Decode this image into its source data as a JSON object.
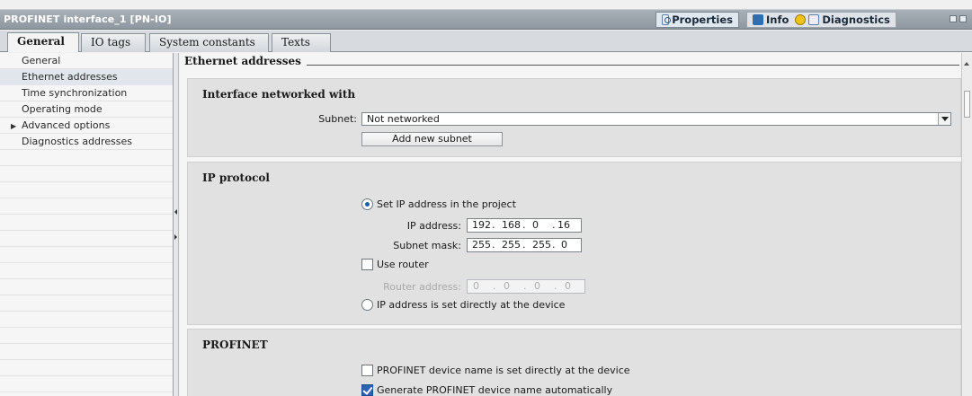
{
  "window": {
    "title": "PROFINET interface_1 [PN-IO]",
    "inspector_tabs": [
      {
        "label": "Properties",
        "icon": "properties-icon",
        "active": true
      },
      {
        "label": "Info",
        "icon": "info-icon",
        "active": false
      },
      {
        "label": "Diagnostics",
        "icon": "diagnostics-icon",
        "active": false
      }
    ]
  },
  "tabs": [
    "General",
    "IO tags",
    "System constants",
    "Texts"
  ],
  "nav": {
    "items": [
      {
        "label": "General"
      },
      {
        "label": "Ethernet addresses"
      },
      {
        "label": "Time synchronization"
      },
      {
        "label": "Operating mode"
      },
      {
        "label": "Advanced options"
      },
      {
        "label": "Diagnostics addresses"
      }
    ]
  },
  "main": {
    "section_title": "Ethernet addresses",
    "interface_panel": {
      "heading": "Interface networked with",
      "subnet_label": "Subnet:",
      "subnet_value": "Not networked",
      "add_subnet_label": "Add new subnet"
    },
    "ip_panel": {
      "heading": "IP protocol",
      "set_ip_label": "Set IP address in the project",
      "ip_label": "IP address:",
      "ip": [
        "192",
        "168",
        "0",
        "16"
      ],
      "mask_label": "Subnet mask:",
      "mask": [
        "255",
        "255",
        "255",
        "0"
      ],
      "use_router_label": "Use router",
      "router_label": "Router address:",
      "router": [
        "0",
        "0",
        "0",
        "0"
      ],
      "ip_at_device_label": "IP address is set directly at the device"
    },
    "profinet_panel": {
      "heading": "PROFINET",
      "name_at_device_label": "PROFINET device name is set directly at the device",
      "generate_name_label": "Generate PROFINET device name automatically"
    }
  }
}
